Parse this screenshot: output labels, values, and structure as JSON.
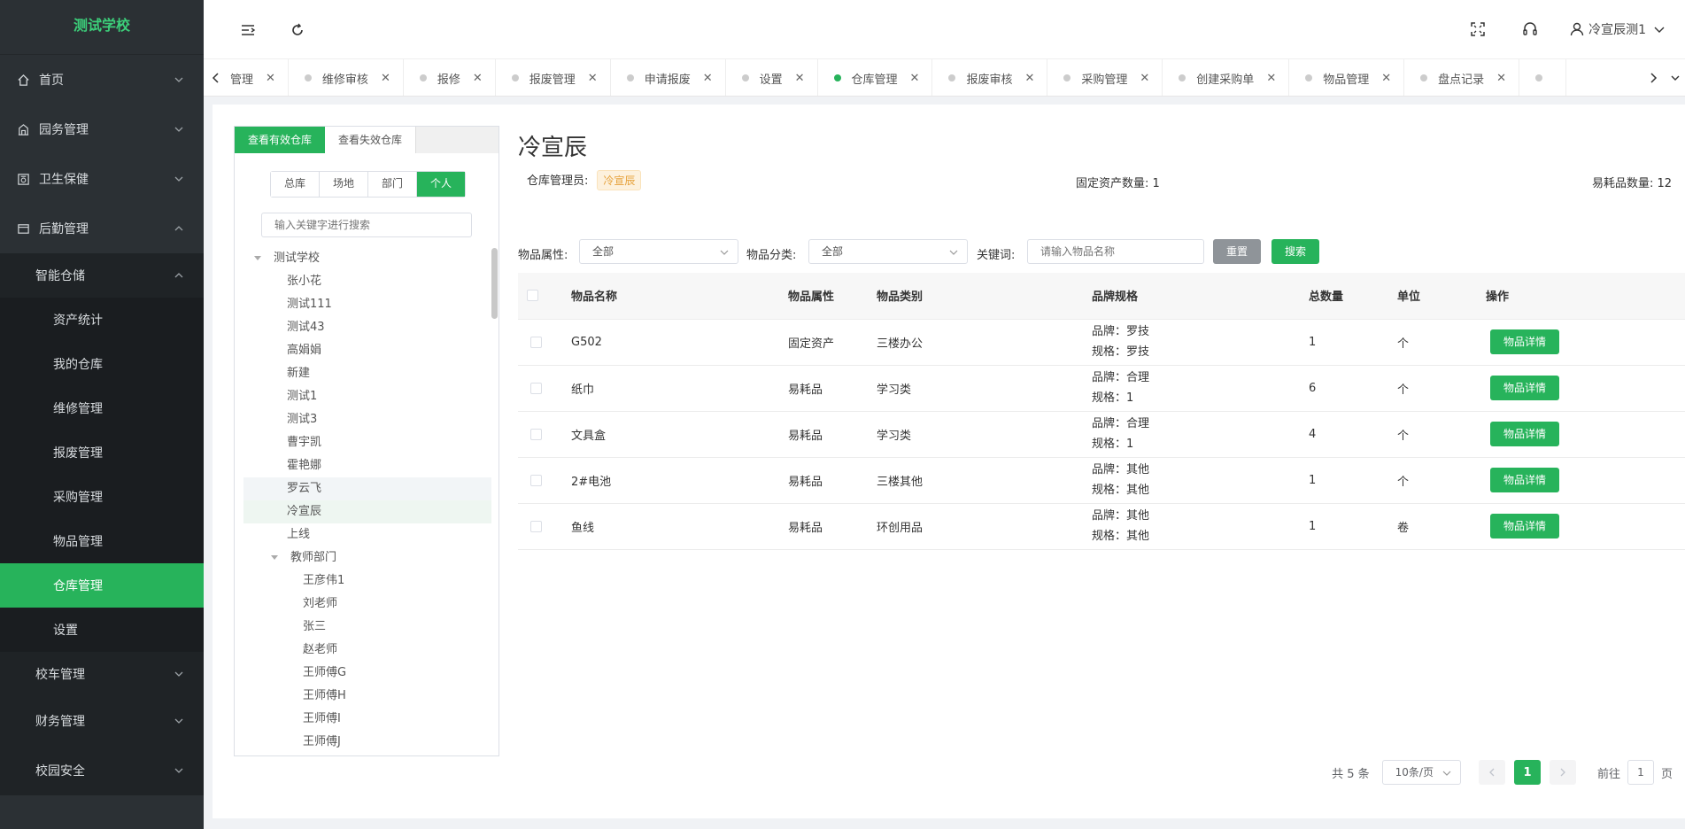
{
  "app": {
    "title": "测试学校"
  },
  "sidebar": {
    "items": [
      {
        "label": "首页"
      },
      {
        "label": "园务管理"
      },
      {
        "label": "卫生保健"
      },
      {
        "label": "后勤管理"
      }
    ],
    "smart_storage": {
      "label": "智能仓储"
    },
    "sub_items": [
      {
        "label": "资产统计"
      },
      {
        "label": "我的仓库"
      },
      {
        "label": "维修管理"
      },
      {
        "label": "报废管理"
      },
      {
        "label": "采购管理"
      },
      {
        "label": "物品管理"
      },
      {
        "label": "仓库管理"
      },
      {
        "label": "设置"
      }
    ],
    "bottom_items": [
      {
        "label": "校车管理"
      },
      {
        "label": "财务管理"
      },
      {
        "label": "校园安全"
      }
    ]
  },
  "header": {
    "user_name": "冷宣辰测1"
  },
  "tabs": [
    {
      "label": "管理"
    },
    {
      "label": "维修审核"
    },
    {
      "label": "报修"
    },
    {
      "label": "报废管理"
    },
    {
      "label": "申请报废"
    },
    {
      "label": "设置"
    },
    {
      "label": "仓库管理"
    },
    {
      "label": "报废审核"
    },
    {
      "label": "采购管理"
    },
    {
      "label": "创建采购单"
    },
    {
      "label": "物品管理"
    },
    {
      "label": "盘点记录"
    }
  ],
  "tree_panel": {
    "tab_active": "查看有效仓库",
    "tab_inactive": "查看失效仓库",
    "segments": [
      "总库",
      "场地",
      "部门",
      "个人"
    ],
    "search_placeholder": "输入关键字进行搜索",
    "root": "测试学校",
    "nodes": [
      "张小花",
      "测试111",
      "测试43",
      "高娟娟",
      "新建",
      "测试1",
      "测试3",
      "曹宇凯",
      "霍艳娜",
      "罗云飞",
      "冷宣辰",
      "上线"
    ],
    "group": "教师部门",
    "group_nodes": [
      "王彦伟1",
      "刘老师",
      "张三",
      "赵老师",
      "王师傅G",
      "王师傅H",
      "王师傅I",
      "王师傅J"
    ]
  },
  "detail": {
    "title": "冷宣辰",
    "manager_label": "仓库管理员:",
    "manager_value": "冷宣辰",
    "fixed_label": "固定资产数量:",
    "fixed_value": "1",
    "consumable_label": "易耗品数量:",
    "consumable_value": "12"
  },
  "filters": {
    "attr_label": "物品属性:",
    "attr_value": "全部",
    "cat_label": "物品分类:",
    "cat_value": "全部",
    "kw_label": "关键词:",
    "kw_placeholder": "请输入物品名称",
    "reset": "重置",
    "search": "搜索"
  },
  "table": {
    "headers": [
      "物品名称",
      "物品属性",
      "物品类别",
      "品牌规格",
      "总数量",
      "单位",
      "操作"
    ],
    "rows": [
      {
        "name": "G502",
        "attr": "固定资产",
        "category": "三楼办公",
        "brand": "品牌：罗技",
        "spec": "规格：罗技",
        "qty": "1",
        "unit": "个",
        "action": "物品详情"
      },
      {
        "name": "纸巾",
        "attr": "易耗品",
        "category": "学习类",
        "brand": "品牌：合理",
        "spec": "规格：1",
        "qty": "6",
        "unit": "个",
        "action": "物品详情"
      },
      {
        "name": "文具盒",
        "attr": "易耗品",
        "category": "学习类",
        "brand": "品牌：合理",
        "spec": "规格：1",
        "qty": "4",
        "unit": "个",
        "action": "物品详情"
      },
      {
        "name": "2#电池",
        "attr": "易耗品",
        "category": "三楼其他",
        "brand": "品牌：其他",
        "spec": "规格：其他",
        "qty": "1",
        "unit": "个",
        "action": "物品详情"
      },
      {
        "name": "鱼线",
        "attr": "易耗品",
        "category": "环创用品",
        "brand": "品牌：其他",
        "spec": "规格：其他",
        "qty": "1",
        "unit": "卷",
        "action": "物品详情"
      }
    ]
  },
  "pagination": {
    "total": "共 5 条",
    "page_size": "10条/页",
    "current": "1",
    "goto_prefix": "前往",
    "goto_value": "1",
    "goto_suffix": "页"
  },
  "colors": {
    "accent": "#27b35b",
    "sidebar_bg": "#2b3034"
  }
}
